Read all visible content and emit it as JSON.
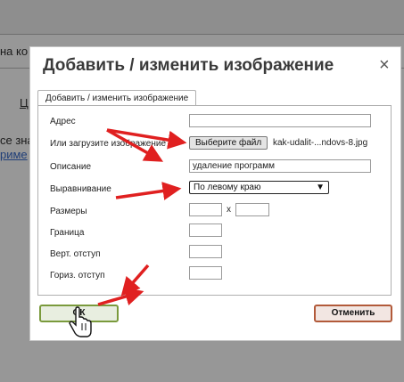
{
  "background": {
    "text_top": "на ко",
    "text_mid": "се зна",
    "text_link": "риме",
    "underline_char": "Ц"
  },
  "dialog": {
    "title": "Добавить / изменить изображение",
    "close_glyph": "×",
    "tab_label": "Добавить / изменить изображение",
    "fields": {
      "address_label": "Адрес",
      "upload_label": "Или загрузите изображение",
      "file_button": "Выберите файл",
      "file_name": "kak-udalit-...ndovs-8.jpg",
      "description_label": "Описание",
      "description_value": "удаление программ",
      "align_label": "Выравнивание",
      "align_value": "По левому краю",
      "size_label": "Размеры",
      "size_sep": "x",
      "border_label": "Граница",
      "vspace_label": "Верт. отступ",
      "hspace_label": "Гориз. отступ"
    },
    "ok_label": "ОК",
    "cancel_label": "Отменить"
  },
  "colors": {
    "arrow": "#e02020",
    "ok_border": "#7a9a3c",
    "cancel_border": "#b25a3a"
  },
  "icons": {
    "cursor": "hand-pointer-icon",
    "select_arrow": "chevron-down-icon"
  }
}
